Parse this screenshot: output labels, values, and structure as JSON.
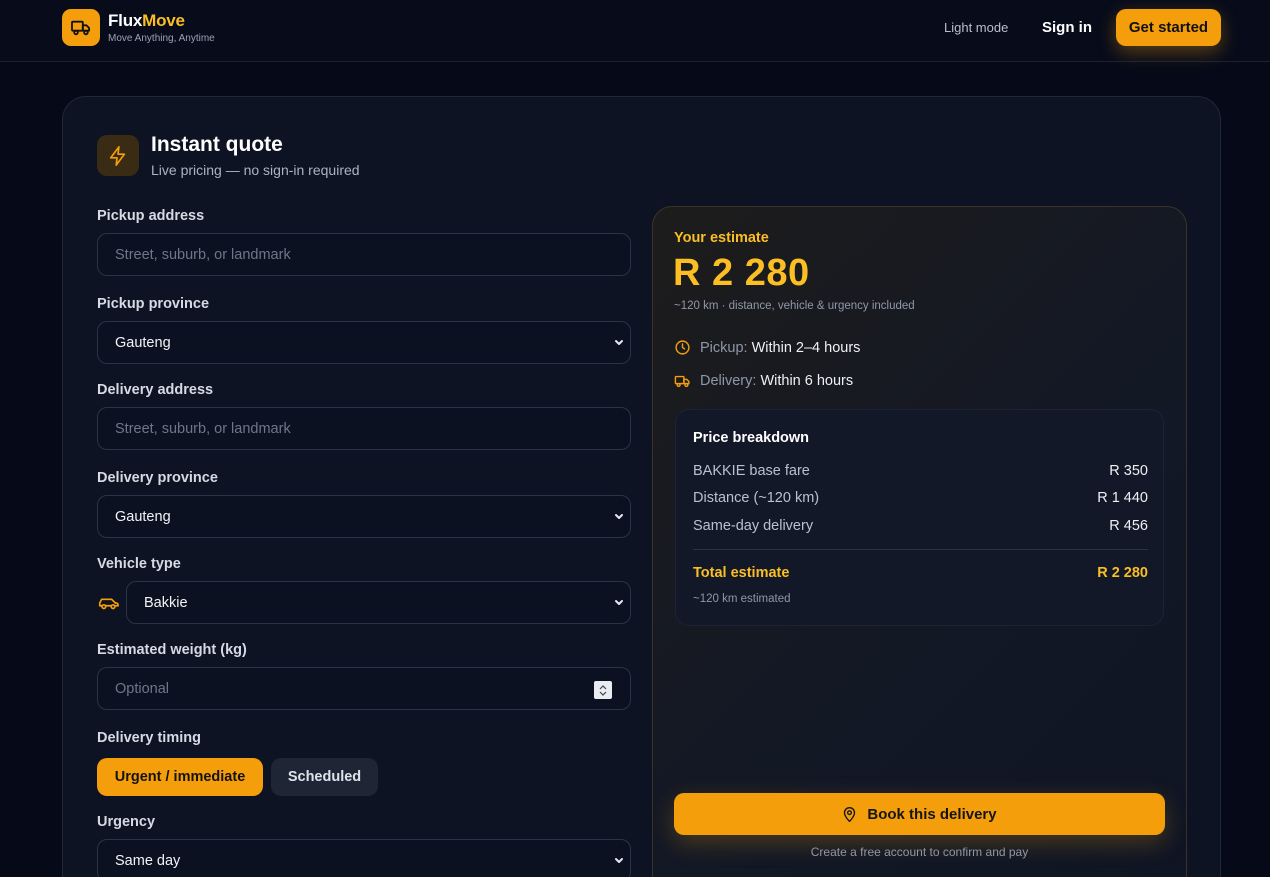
{
  "header": {
    "brand_part1": "Flux",
    "brand_part2": "Move",
    "tagline": "Move Anything, Anytime",
    "theme_toggle": "Light mode",
    "sign_in": "Sign in",
    "get_started": "Get started"
  },
  "quote": {
    "title": "Instant quote",
    "subtitle": "Live pricing — no sign-in required"
  },
  "form": {
    "pickup_address": {
      "label": "Pickup address",
      "placeholder": "Street, suburb, or landmark"
    },
    "pickup_province": {
      "label": "Pickup province",
      "value": "Gauteng"
    },
    "delivery_address": {
      "label": "Delivery address",
      "placeholder": "Street, suburb, or landmark"
    },
    "delivery_province": {
      "label": "Delivery province",
      "value": "Gauteng"
    },
    "vehicle_type": {
      "label": "Vehicle type",
      "value": "Bakkie"
    },
    "weight": {
      "label": "Estimated weight (kg)",
      "placeholder": "Optional"
    },
    "timing": {
      "label": "Delivery timing",
      "options": [
        "Urgent / immediate",
        "Scheduled"
      ],
      "selected": "Urgent / immediate"
    },
    "urgency": {
      "label": "Urgency",
      "value": "Same day"
    }
  },
  "estimate": {
    "label": "Your estimate",
    "amount": "R 2 280",
    "note": "~120 km · distance, vehicle & urgency included",
    "pickup_key": "Pickup:",
    "pickup_val": "Within 2–4 hours",
    "delivery_key": "Delivery:",
    "delivery_val": "Within 6 hours",
    "breakdown": {
      "title": "Price breakdown",
      "rows": [
        {
          "label": "BAKKIE base fare",
          "amount": "R 350"
        },
        {
          "label": "Distance (~120 km)",
          "amount": "R 1 440"
        },
        {
          "label": "Same-day delivery",
          "amount": "R 456"
        }
      ],
      "total_label": "Total estimate",
      "total_amount": "R 2 280",
      "total_note": "~120 km estimated"
    },
    "book_button": "Book this delivery",
    "book_note": "Create a free account to confirm and pay"
  },
  "colors": {
    "accent": "#f59e0b",
    "accent_text": "#fbbf24",
    "background": "#060a18",
    "card": "#0d1322"
  }
}
